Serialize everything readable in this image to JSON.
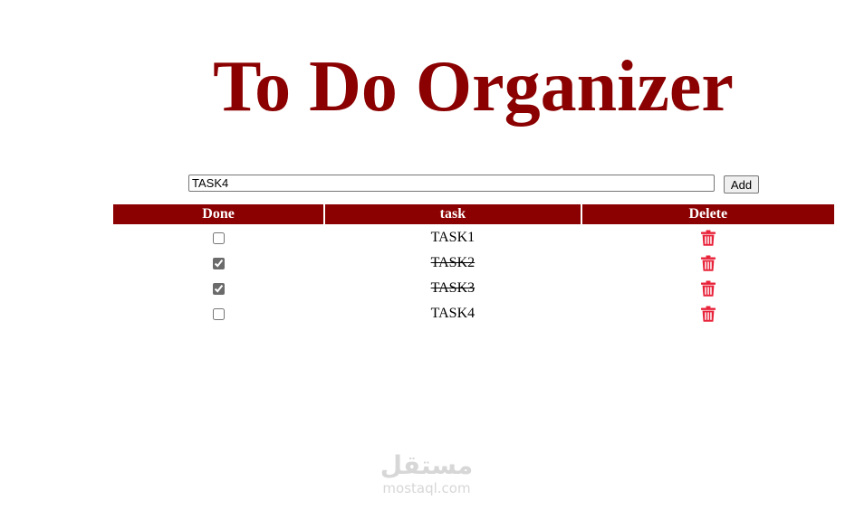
{
  "app": {
    "title": "To Do Organizer"
  },
  "form": {
    "input_value": "TASK4",
    "add_label": "Add"
  },
  "table": {
    "headers": [
      "Done",
      "task",
      "Delete"
    ],
    "rows": [
      {
        "task": "TASK1",
        "done": false
      },
      {
        "task": "TASK2",
        "done": true
      },
      {
        "task": "TASK3",
        "done": true
      },
      {
        "task": "TASK4",
        "done": false
      }
    ]
  },
  "icons": {
    "delete": "trash-icon"
  },
  "colors": {
    "title": "#8b0000",
    "header_bg": "#8b0000",
    "header_text": "#ffffff",
    "delete_icon": "#e8233a"
  },
  "watermark": {
    "logo": "مستقل",
    "site": "mostaql.com"
  }
}
